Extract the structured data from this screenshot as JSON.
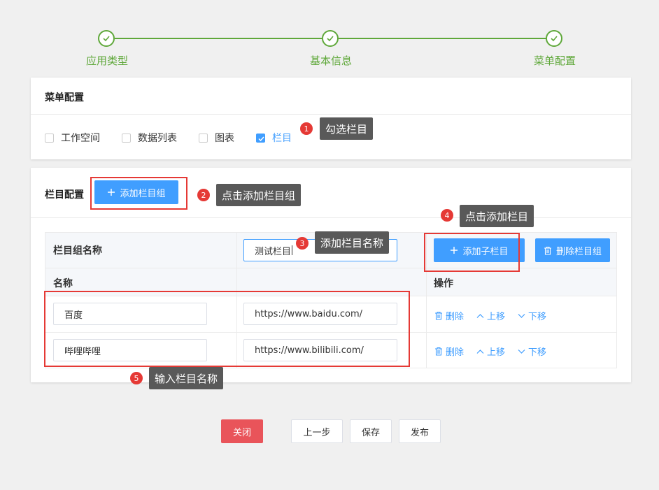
{
  "steps": [
    {
      "label": "应用类型"
    },
    {
      "label": "基本信息"
    },
    {
      "label": "菜单配置"
    }
  ],
  "menu_config": {
    "title": "菜单配置",
    "options": [
      {
        "label": "工作空间",
        "checked": false
      },
      {
        "label": "数据列表",
        "checked": false
      },
      {
        "label": "图表",
        "checked": false
      },
      {
        "label": "栏目",
        "checked": true
      }
    ]
  },
  "column_config": {
    "title": "栏目配置",
    "add_group_label": "添加栏目组",
    "group_name_header": "栏目组名称",
    "group_name_value": "测试栏目",
    "add_sub_label": "添加子栏目",
    "delete_group_label": "删除栏目组",
    "name_header": "名称",
    "action_header": "操作",
    "rows": [
      {
        "name": "百度",
        "url": "https://www.baidu.com/"
      },
      {
        "name": "哔哩哔哩",
        "url": "https://www.bilibili.com/"
      }
    ],
    "ops": {
      "delete": "删除",
      "up": "上移",
      "down": "下移"
    }
  },
  "annotations": [
    {
      "num": "1",
      "text": "勾选栏目"
    },
    {
      "num": "2",
      "text": "点击添加栏目组"
    },
    {
      "num": "3",
      "text": "添加栏目名称"
    },
    {
      "num": "4",
      "text": "点击添加栏目"
    },
    {
      "num": "5",
      "text": "输入栏目名称"
    }
  ],
  "footer": {
    "close": "关闭",
    "prev": "上一步",
    "save": "保存",
    "publish": "发布"
  },
  "colors": {
    "step_green": "#5fa83a",
    "primary_blue": "#409eff",
    "annotation_red": "#e53935",
    "close_red": "#e9545a"
  }
}
